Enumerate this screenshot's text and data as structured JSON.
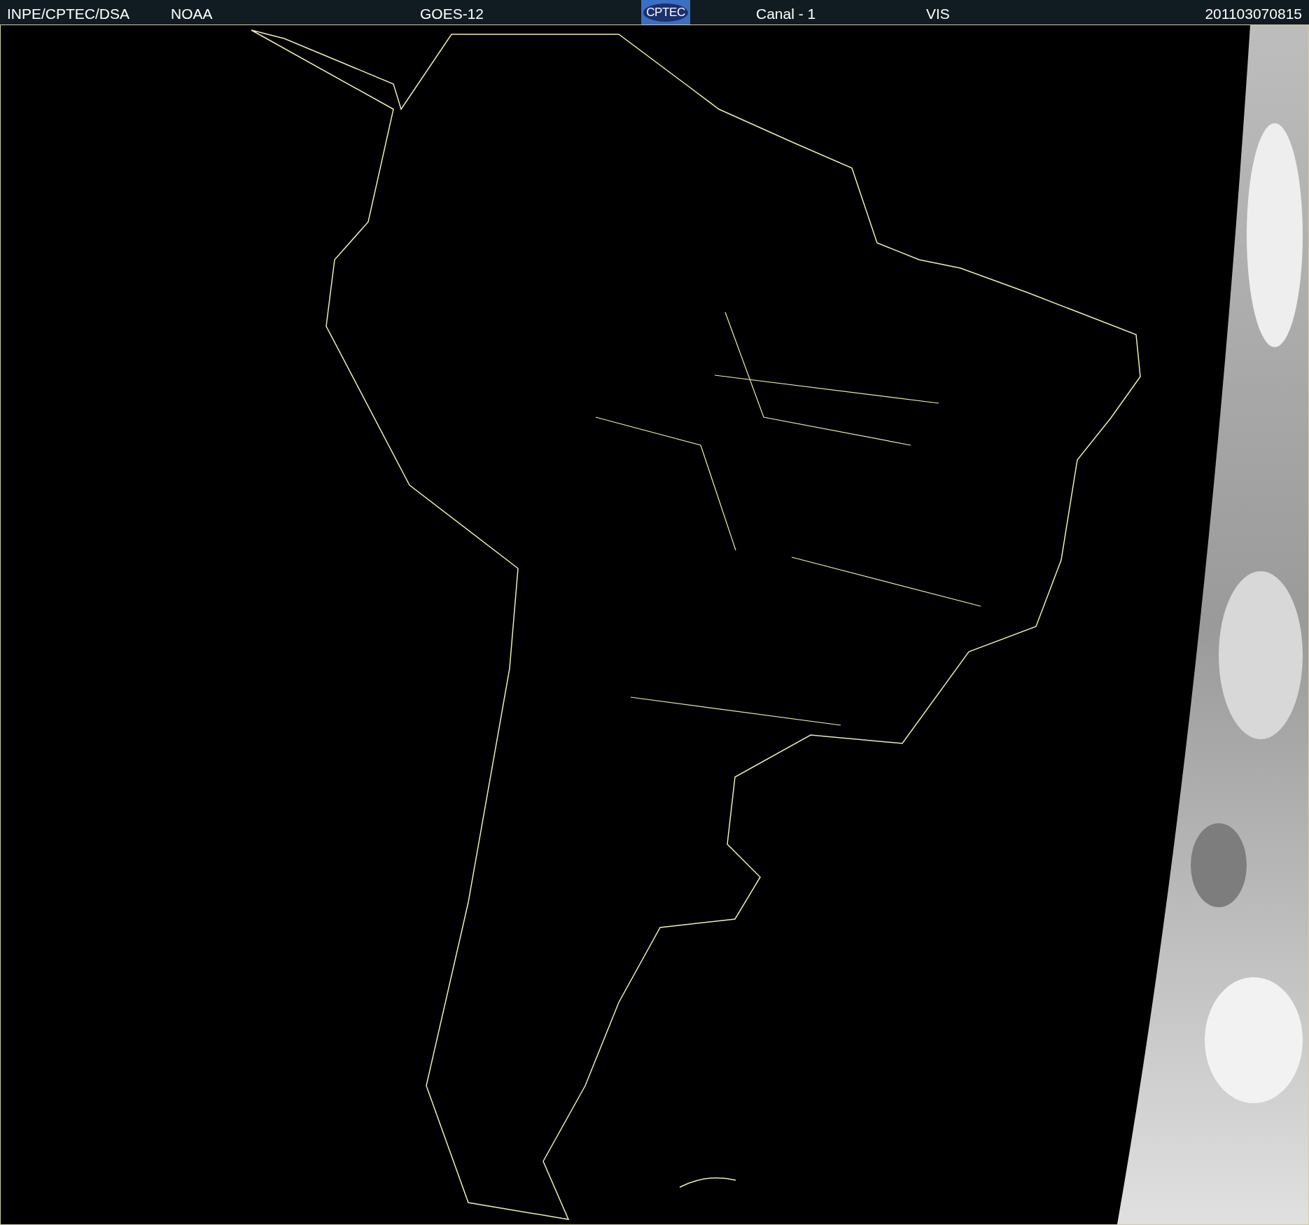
{
  "header": {
    "agency": "INPE/CPTEC/DSA",
    "source": "NOAA",
    "satellite": "GOES-12",
    "logo": "CPTEC",
    "channel": "Canal - 1",
    "band": "VIS",
    "timestamp": "201103070815"
  }
}
